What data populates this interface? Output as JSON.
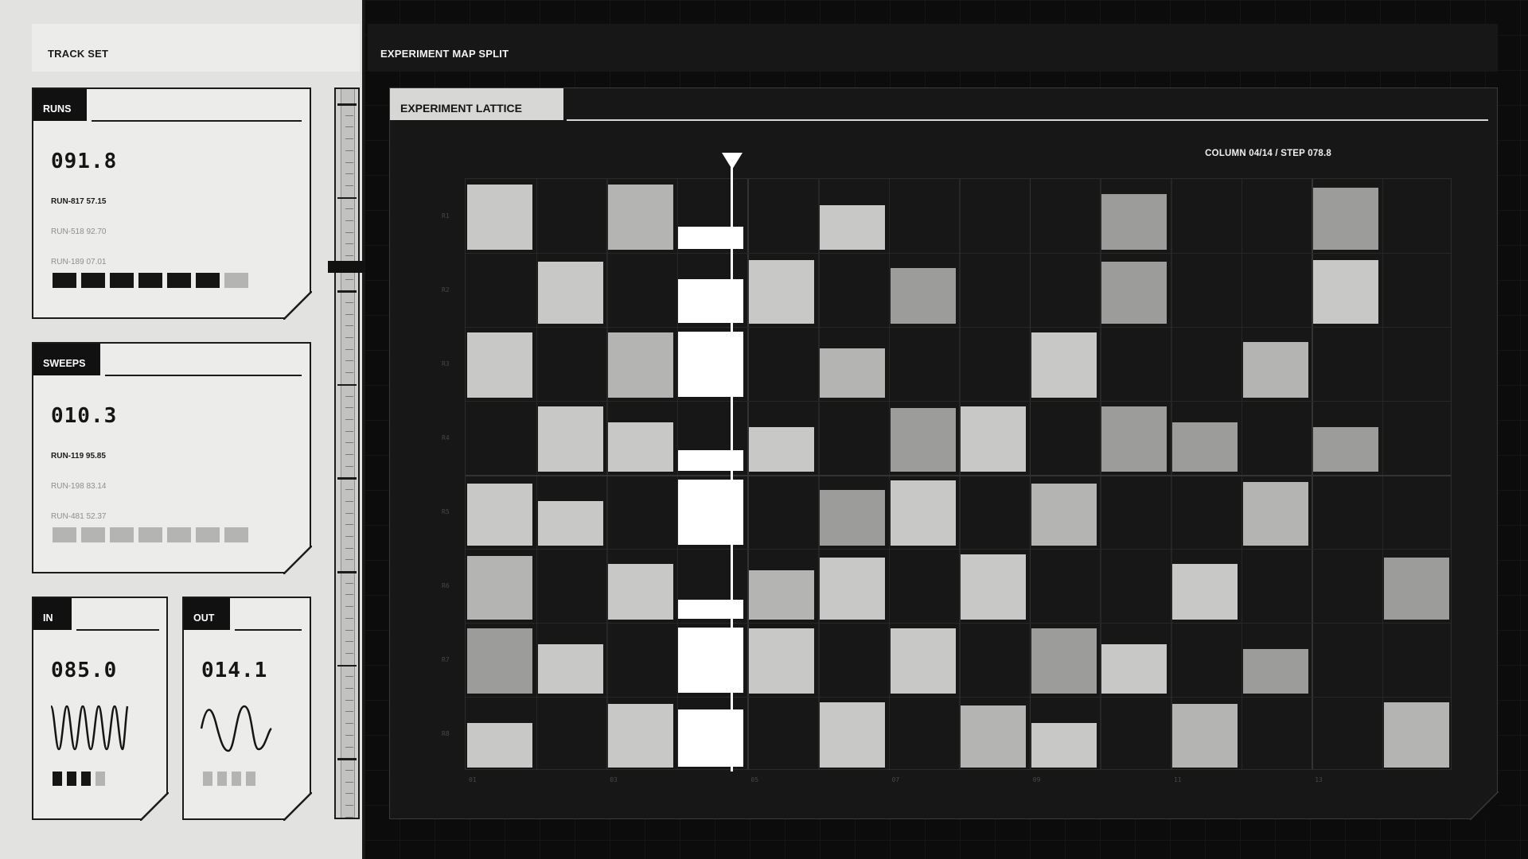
{
  "left_header": {
    "title": "TRACK SET"
  },
  "right_header": {
    "title": "EXPERIMENT MAP SPLIT"
  },
  "cards": {
    "runs": {
      "tag": "RUNS",
      "value": "091.8",
      "rows": [
        "RUN-817 57.15",
        "RUN-518 92.70",
        "RUN-189 07.01"
      ],
      "squares_filled": 6,
      "squares_total": 7
    },
    "sweeps": {
      "tag": "SWEEPS",
      "value": "010.3",
      "rows": [
        "RUN-119 95.85",
        "RUN-198 83.14",
        "RUN-481 52.37"
      ],
      "squares_filled": 0,
      "squares_total": 7
    },
    "in": {
      "tag": "IN",
      "value": "085.0",
      "squares_filled": 3,
      "squares_total": 4
    },
    "out": {
      "tag": "OUT",
      "value": "014.1",
      "squares_filled": 0,
      "squares_total": 4
    }
  },
  "panel": {
    "tab": "EXPERIMENT LATTICE",
    "readout": "COLUMN 04/14 / STEP 078.8",
    "row_labels": [
      "R1",
      "R2",
      "R3",
      "R4",
      "R5",
      "R6",
      "R7",
      "R8"
    ],
    "col_labels": [
      "01",
      "03",
      "05",
      "07",
      "09",
      "11",
      "13"
    ],
    "active_column": 4,
    "step": 78.8
  },
  "colors": {
    "accent": "#ffffff",
    "dark_bg": "#161716",
    "light_bg": "#e2e3e1"
  }
}
